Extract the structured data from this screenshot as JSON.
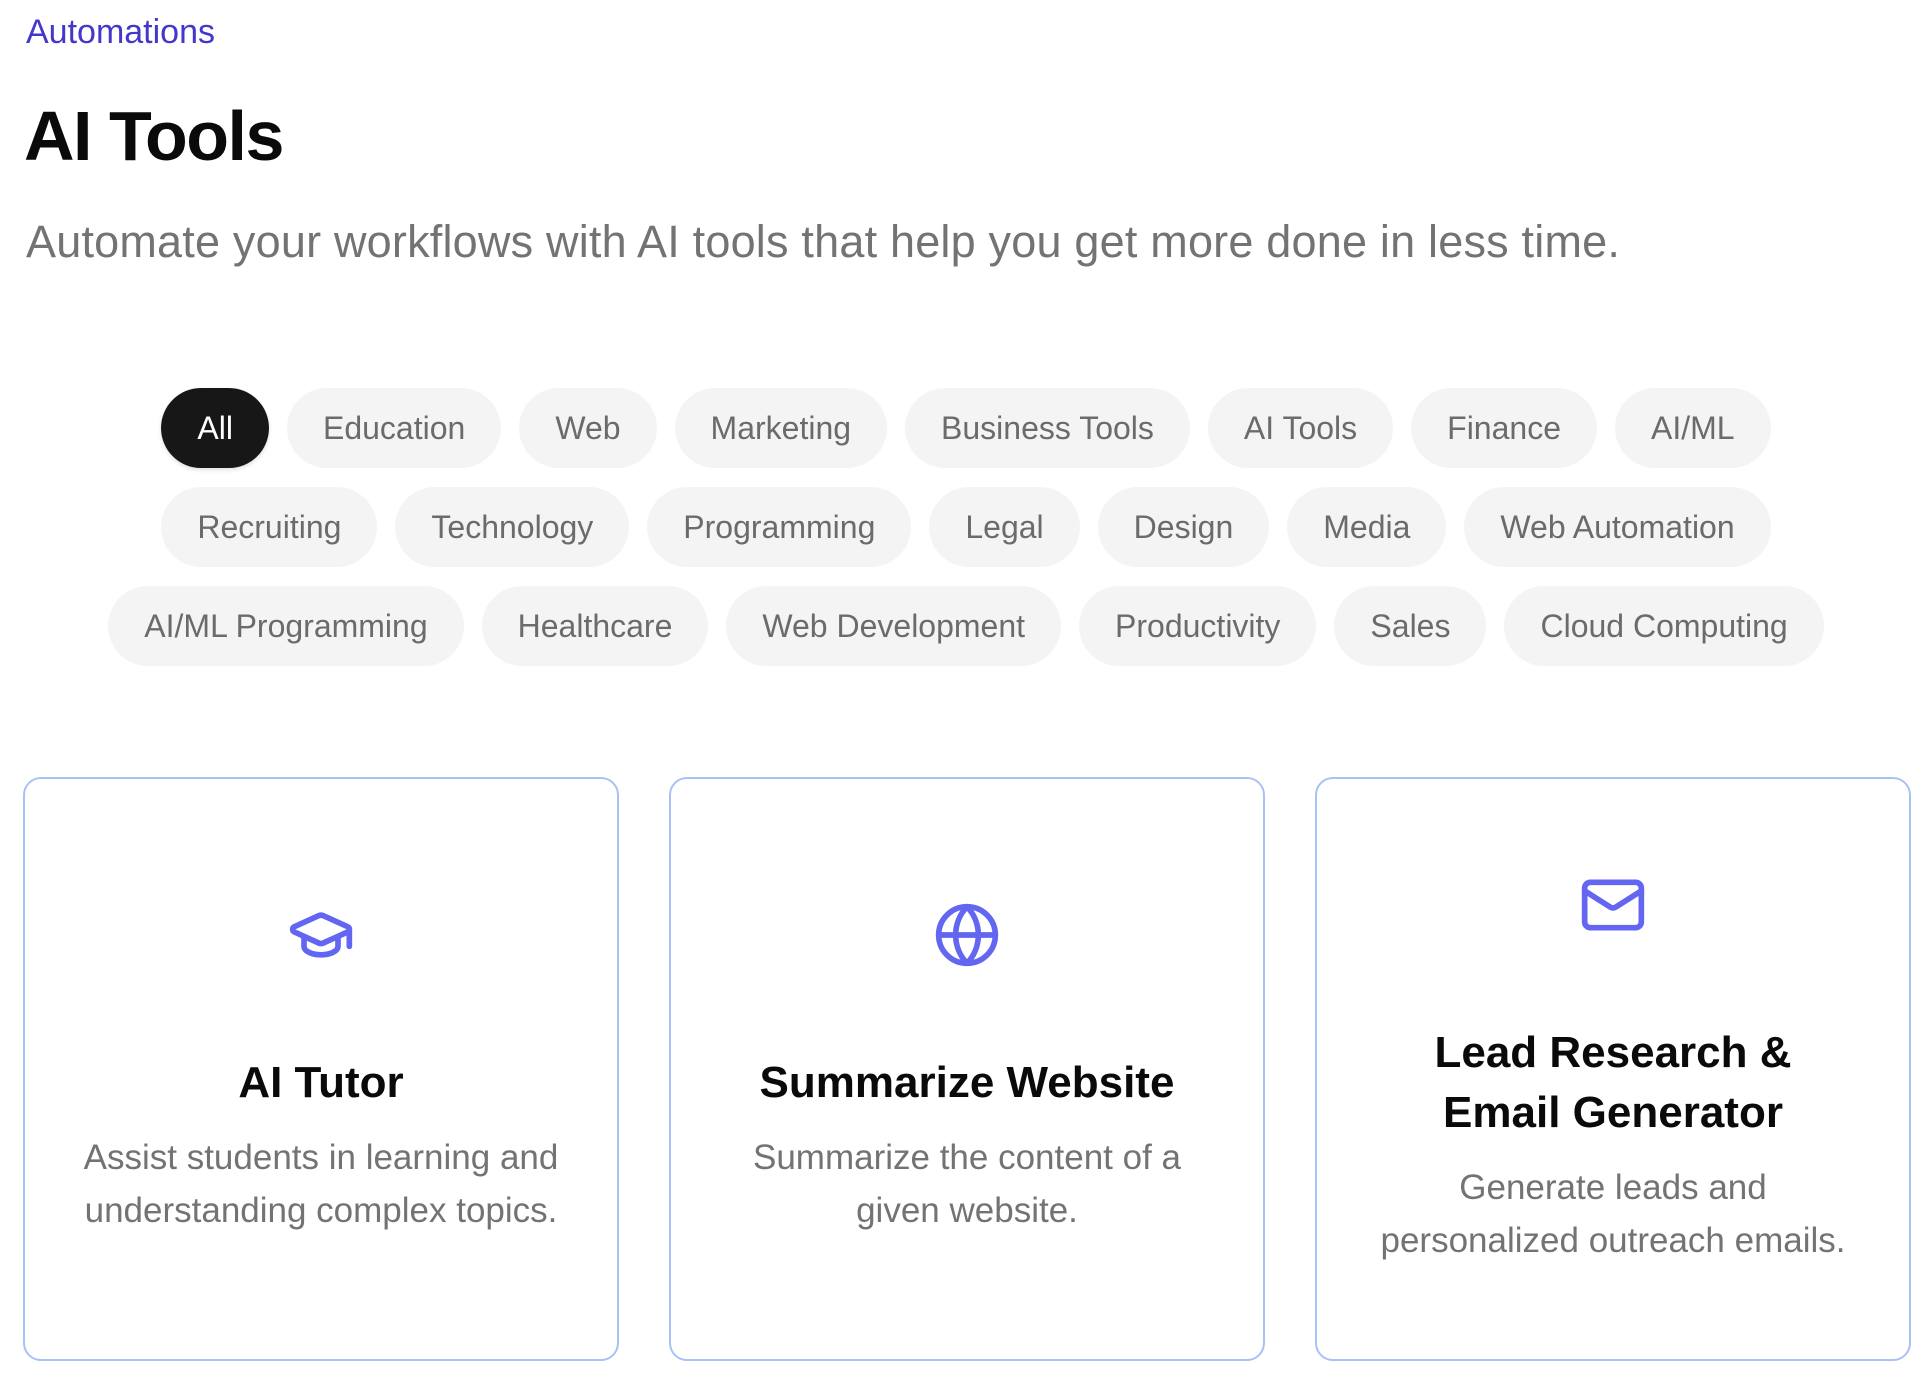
{
  "breadcrumb": {
    "label": "Automations"
  },
  "header": {
    "title": "AI Tools",
    "subtitle": "Automate your workflows with AI tools that help you get more done in less time."
  },
  "filters": {
    "active": "All",
    "rows": [
      [
        "All",
        "Education",
        "Web",
        "Marketing",
        "Business Tools",
        "AI Tools",
        "Finance",
        "AI/ML"
      ],
      [
        "Recruiting",
        "Technology",
        "Programming",
        "Legal",
        "Design",
        "Media",
        "Web Automation"
      ],
      [
        "AI/ML Programming",
        "Healthcare",
        "Web Development",
        "Productivity",
        "Sales",
        "Cloud Computing"
      ]
    ]
  },
  "colors": {
    "accent": "#4338CA",
    "icon": "#6366F1",
    "card_border": "#A9C2F5",
    "chip_active_bg": "#171717",
    "chip_bg": "#F4F4F4"
  },
  "cards": [
    {
      "icon": "graduation-cap-icon",
      "title": "AI Tutor",
      "description": "Assist students in learning and understanding complex topics."
    },
    {
      "icon": "globe-icon",
      "title": "Summarize Website",
      "description": "Summarize the content of a given website."
    },
    {
      "icon": "mail-icon",
      "title": "Lead Research & Email Generator",
      "description": "Generate leads and personalized outreach emails."
    }
  ]
}
